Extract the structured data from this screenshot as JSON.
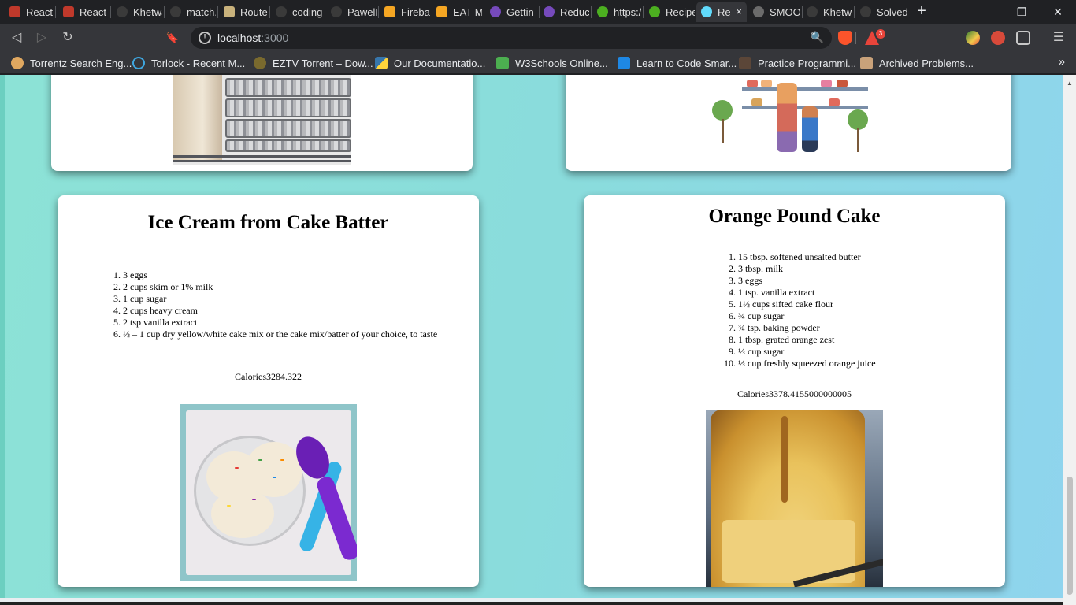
{
  "tabs": [
    {
      "title": "React F",
      "icon": "react-icon"
    },
    {
      "title": "React F",
      "icon": "react-icon"
    },
    {
      "title": "Khetwa",
      "icon": "github-icon"
    },
    {
      "title": "match.",
      "icon": "github-icon"
    },
    {
      "title": "Route",
      "icon": "router-icon"
    },
    {
      "title": "coding",
      "icon": "github-icon"
    },
    {
      "title": "PawelP",
      "icon": "github-icon"
    },
    {
      "title": "Fireba",
      "icon": "firebase-icon"
    },
    {
      "title": "EAT M",
      "icon": "firebase-icon"
    },
    {
      "title": "Gettin",
      "icon": "redux-icon"
    },
    {
      "title": "Reduc",
      "icon": "redux-icon"
    },
    {
      "title": "https:/",
      "icon": "edamam-icon"
    },
    {
      "title": "Recipe",
      "icon": "edamam-icon"
    },
    {
      "title": "Re",
      "icon": "react-icon",
      "active": true,
      "close": "×"
    },
    {
      "title": "SMOO",
      "icon": "globe-icon"
    },
    {
      "title": "Khetw",
      "icon": "github-icon"
    },
    {
      "title": "Solved",
      "icon": "github-icon"
    }
  ],
  "new_tab": "+",
  "window_controls": {
    "minimize": "—",
    "restore": "❐",
    "close": "✕"
  },
  "toolbar": {
    "back": "◁",
    "forward": "▷",
    "reload": "↻",
    "bookmark": "🔖",
    "url_host": "localhost",
    "url_port": ":3000",
    "zoom": "🔍",
    "brave_badge": "3",
    "menu": "☰"
  },
  "bookmarks": [
    {
      "label": "Torrentz Search Eng...",
      "icon": "torrentz-icon"
    },
    {
      "label": "Torlock - Recent M...",
      "icon": "torlock-icon"
    },
    {
      "label": "EZTV Torrent – Dow...",
      "icon": "eztv-icon"
    },
    {
      "label": "Our Documentatio...",
      "icon": "python-icon"
    },
    {
      "label": "W3Schools Online...",
      "icon": "w3schools-icon"
    },
    {
      "label": "Learn to Code Smar...",
      "icon": "kotlin-icon"
    },
    {
      "label": "Practice Programmi...",
      "icon": "codechef-icon"
    },
    {
      "label": "Archived Problems...",
      "icon": "projecteuler-icon"
    }
  ],
  "bookmarks_more": "»",
  "recipes": [
    {
      "title": "Ice Cream from Cake Batter",
      "ingredients": [
        "3 eggs",
        "2 cups skim or 1% milk",
        "1 cup sugar",
        "2 cups heavy cream",
        "2 tsp vanilla extract",
        "½ – 1 cup dry yellow/white cake mix or the cake mix/batter of your choice, to taste"
      ],
      "calories_label": "Calories",
      "calories": "3284.322",
      "image": "ice-cream-image"
    },
    {
      "title": "Orange Pound Cake",
      "ingredients": [
        "15 tbsp. softened unsalted butter",
        "3 tbsp. milk",
        "3 eggs",
        "1 tsp. vanilla extract",
        "1½ cups sifted cake flour",
        "¾ cup sugar",
        "¾ tsp. baking powder",
        "1 tbsp. grated orange zest",
        "⅓ cup sugar",
        "⅓ cup freshly squeezed orange juice"
      ],
      "calories_label": "Calories",
      "calories": "3378.4155000000005",
      "image": "pound-cake-image"
    }
  ],
  "colors": {
    "page_gradient_start": "#8ce2d6",
    "page_gradient_end": "#8fd4ee",
    "card": "#ffffff",
    "chrome_dark": "#202124",
    "chrome_toolbar": "#35363a"
  }
}
